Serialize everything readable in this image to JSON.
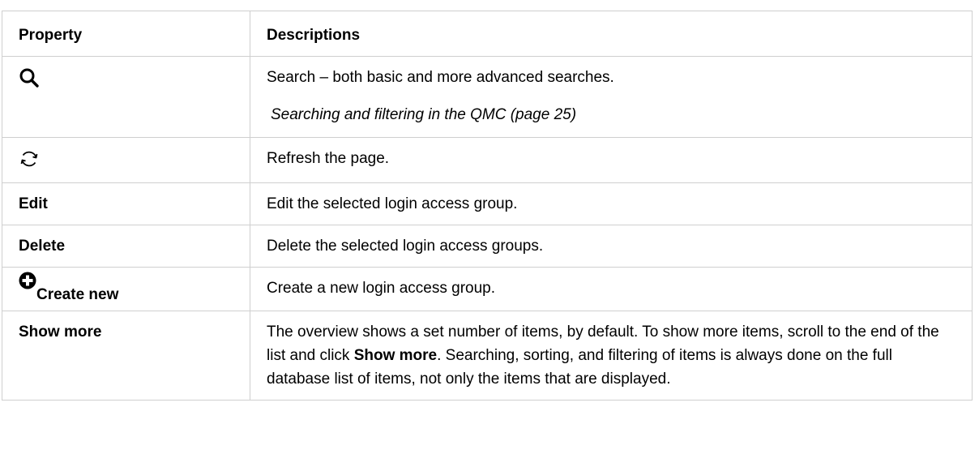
{
  "table": {
    "headers": {
      "property": "Property",
      "descriptions": "Descriptions"
    },
    "rows": {
      "search": {
        "icon": "search-icon",
        "description": "Search – both basic and more advanced searches.",
        "link": "Searching and filtering in the QMC (page 25)"
      },
      "refresh": {
        "icon": "refresh-icon",
        "description": "Refresh the page."
      },
      "edit": {
        "property": "Edit",
        "description": "Edit the selected login access group."
      },
      "delete": {
        "property": "Delete",
        "description": "Delete the selected login access groups."
      },
      "create_new": {
        "icon": "plus-circle-icon",
        "property": "Create new",
        "description": "Create a new login access group."
      },
      "show_more": {
        "property": "Show more",
        "description_before": "The overview shows a set number of items, by default. To show more items, scroll to the end of the list and click ",
        "description_bold": "Show more",
        "description_after": ". Searching, sorting, and filtering of items is always done on the full database list of items, not only the items that are displayed."
      }
    }
  }
}
